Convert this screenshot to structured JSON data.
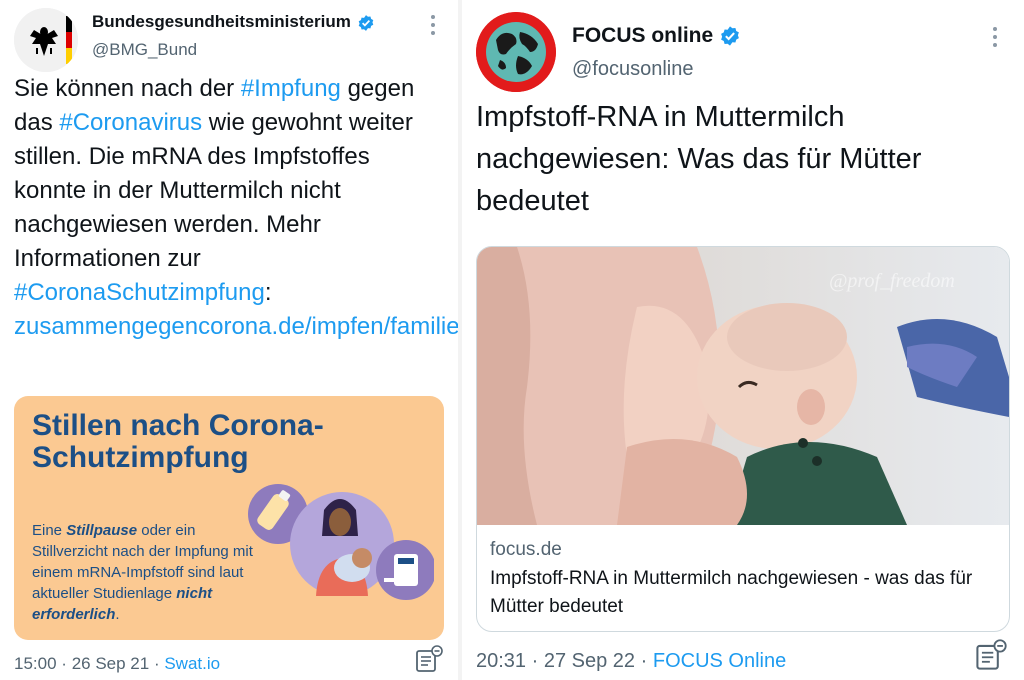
{
  "left_tweet": {
    "author_name": "Bundesgesundheitsministerium",
    "author_handle": "@BMG_Bund",
    "text_parts": [
      "Sie können nach der ",
      "#Impfung",
      " gegen das ",
      "#Coronavirus",
      " wie gewohnt weiter stillen. Die mRNA des Impfstoffes konnte in der Muttermilch nicht nachgewiesen werden. Mehr Informationen zur ",
      "#CoronaSchutzimpfung",
      ": ",
      "zusammengegencorona.de/impfen/familie..."
    ],
    "card": {
      "title": "Stillen nach Corona-Schutzimpfung",
      "body_parts": [
        "Eine ",
        "Stillpause",
        " oder ein Stillverzicht nach der Impfung mit einem mRNA-Impfstoff sind laut aktueller Studienlage ",
        "nicht erforderlich",
        "."
      ],
      "bg_color": "#fbc992",
      "text_color": "#1c4f86"
    },
    "time": "15:00",
    "date": "26 Sep 21",
    "source": "Swat.io",
    "separator": "·"
  },
  "right_tweet": {
    "author_name": "FOCUS online",
    "author_handle": "@focusonline",
    "headline": "Impfstoff-RNA in Muttermilch nachgewiesen: Was das für Mütter bedeutet",
    "image_watermark": "@prof_freedom",
    "link_domain": "focus.de",
    "link_title": "Impfstoff-RNA in Muttermilch nachgewiesen - was das für Mütter bedeutet",
    "time": "20:31",
    "date": "27 Sep 22",
    "source": "FOCUS Online",
    "separator": "·"
  },
  "colors": {
    "link_blue": "#1d9bf0",
    "verified_blue": "#1d9bf0",
    "secondary_text": "#536471"
  },
  "icons": [
    "verified-badge-icon",
    "more-options-icon",
    "tweet-tool-icon",
    "federal-eagle-logo",
    "globe-logo"
  ]
}
